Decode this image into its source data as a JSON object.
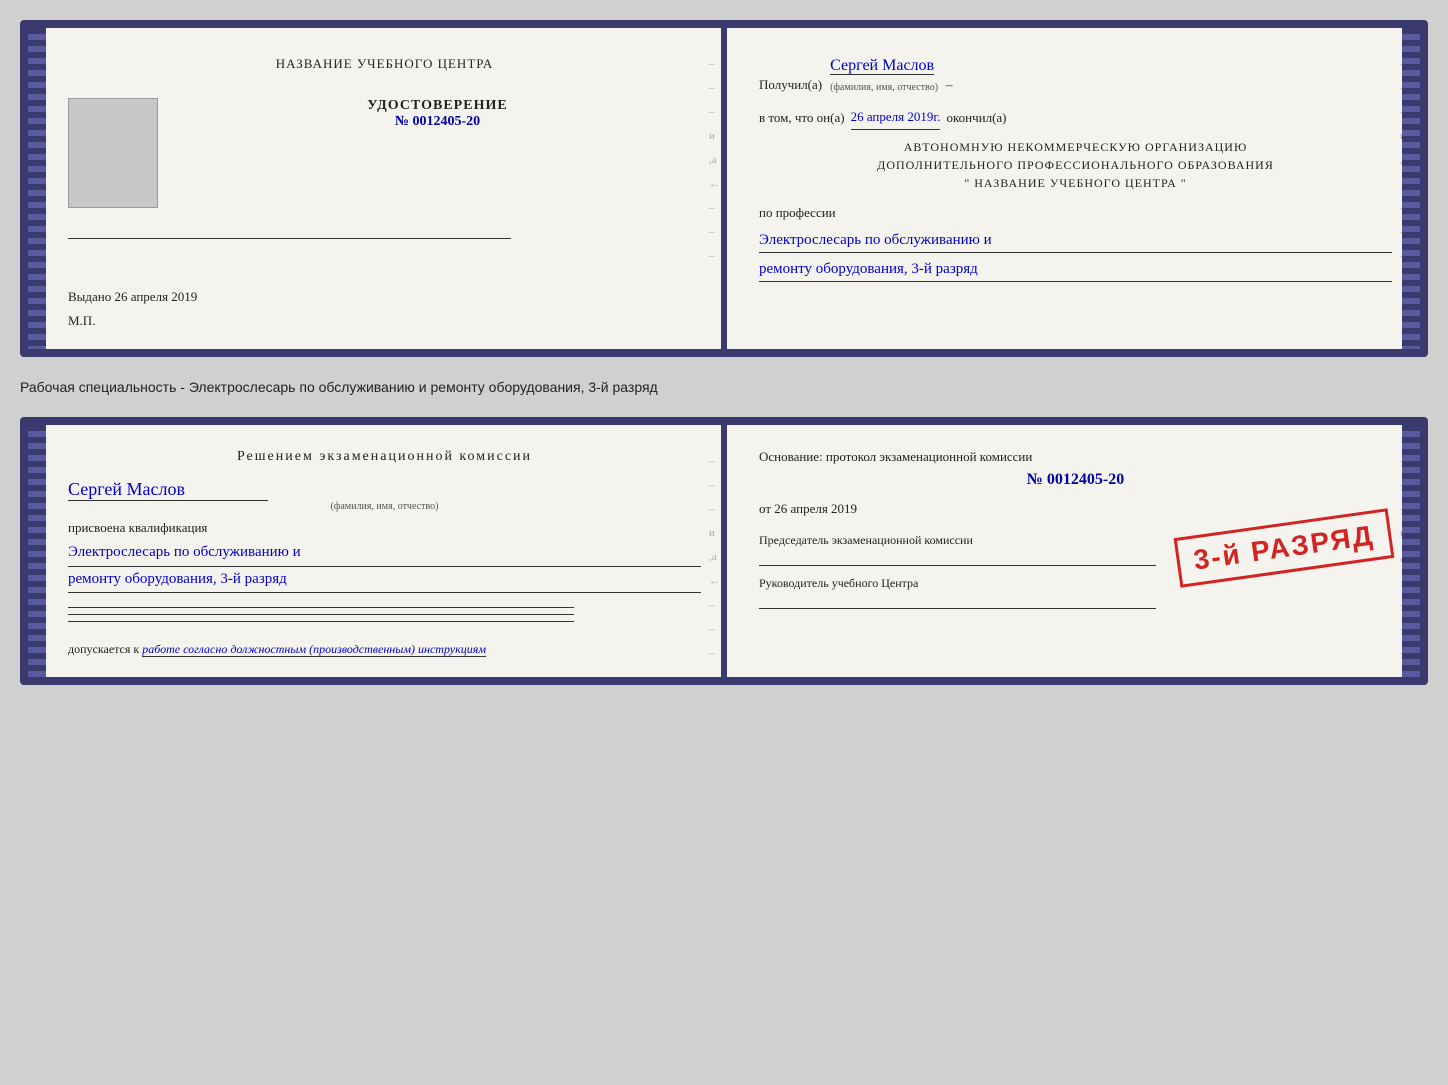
{
  "top_cert": {
    "left": {
      "title": "НАЗВАНИЕ УЧЕБНОГО ЦЕНТРА",
      "photo_alt": "photo",
      "udost_label": "УДОСТОВЕРЕНИЕ",
      "udost_number": "№ 0012405-20",
      "issued_label": "Выдано",
      "issued_date": "26 апреля 2019",
      "mp_label": "М.П."
    },
    "right": {
      "received_label": "Получил(а)",
      "recipient_name": "Сергей Маслов",
      "fio_sub": "(фамилия, имя, отчество)",
      "dash": "–",
      "date_line_prefix": "в том, что он(а)",
      "date_value": "26 апреля 2019г.",
      "date_line_suffix": "окончил(а)",
      "org_line1": "АВТОНОМНУЮ НЕКОММЕРЧЕСКУЮ ОРГАНИЗАЦИЮ",
      "org_line2": "ДОПОЛНИТЕЛЬНОГО ПРОФЕССИОНАЛЬНОГО ОБРАЗОВАНИЯ",
      "org_line3": "\"     НАЗВАНИЕ УЧЕБНОГО ЦЕНТРА     \"",
      "profession_prefix": "по профессии",
      "profession_line1": "Электрослесарь по обслуживанию и",
      "profession_line2": "ремонту оборудования, 3-й разряд"
    }
  },
  "between_text": "Рабочая специальность - Электрослесарь по обслуживанию и ремонту оборудования, 3-й разряд",
  "bottom_cert": {
    "left": {
      "decision_title": "Решением  экзаменационной  комиссии",
      "name": "Сергей Маслов",
      "fio_sub": "(фамилия, имя, отчество)",
      "assigned_label": "присвоена квалификация",
      "qualification_line1": "Электрослесарь по обслуживанию и",
      "qualification_line2": "ремонту оборудования, 3-й разряд",
      "admitted_prefix": "допускается к",
      "admitted_italic": "работе согласно должностным (производственным) инструкциям"
    },
    "right": {
      "basis_text": "Основание: протокол экзаменационной  комиссии",
      "basis_number": "№  0012405-20",
      "from_label": "от",
      "basis_date": "26 апреля 2019",
      "chairman_label": "Председатель экзаменационной комиссии",
      "stamp_text": "3-й РАЗРЯД",
      "director_label": "Руководитель учебного Центра"
    }
  },
  "icons": {
    "dash": "–"
  }
}
